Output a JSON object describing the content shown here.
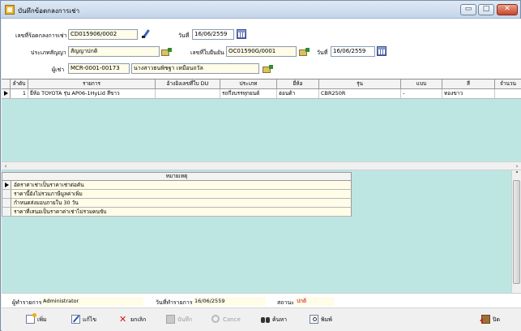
{
  "window": {
    "title": "บันทึกข้อตกลงการเช่า",
    "controls": {
      "minimize": "▭",
      "maximize": "□",
      "close": "✕"
    }
  },
  "form": {
    "agreement_no_label": "เลขที่ร้อตกลงการเช่า",
    "agreement_no_value": "CD015906/0002",
    "date_label": "วันที่",
    "date_value": "16/06/2559",
    "contract_type_label": "ประเภทสัญญา",
    "contract_type_value": "สัญญาปกติ",
    "booking_no_label": "เลขที่ใบยืนยัน",
    "booking_no_value": "OC01590G/0001",
    "booking_date_label": "วันที่",
    "booking_date_value": "16/06/2559",
    "tenant_label": "ผู้เช่า",
    "tenant_code": "MCR-0001-00173",
    "tenant_name": "นางสาวธนพิชฐา เหมือนถวัล"
  },
  "items_grid": {
    "columns": [
      "ลำดับ",
      "รายการ",
      "อ้างอิงเลขที่ใบ DU",
      "ประเภท",
      "ยี่ห้อ",
      "รุ่น",
      "แบบ",
      "สี",
      "จำนวน"
    ],
    "rows": [
      [
        "1",
        "ยี่ห้อ TOYOTA รุ่น AP06-1HyLid สีขาว",
        "",
        "รถกึ่งบรรทุกยนต์",
        "ฮอนด้า",
        "CBR250R",
        "-",
        "ทองขาว",
        ""
      ]
    ]
  },
  "notes_grid": {
    "header": "หมายเหตุ",
    "rows": [
      "อัตราค่าเช่าเป็นราคาเช่าต่อคัน",
      "ราคานี้ยังไม่รวมภาษีมูลค่าเพิ่ม",
      "กำหนดส่งมอบภายใน 30 วัน",
      "ราคาที่เสนอเป็นราคาค่าเช่าไม่รวมคนขับ"
    ]
  },
  "status": {
    "recorder_label": "ผู้ทำรายการ",
    "recorder_value": "Administrator",
    "record_date_label": "วันที่ทำรายการ",
    "record_date_value": "16/06/2559",
    "state_label": "สถานะ",
    "state_value": "ปกติ",
    "state_color": "#d01010"
  },
  "toolbar": {
    "add": "เพิ่ม",
    "edit": "แก้ไข",
    "cancel_doc": "ยกเลิก",
    "save": "บันทึก",
    "cancel": "Cance",
    "search": "ค้นหา",
    "print": "พิมพ์",
    "close": "ปิด"
  },
  "scroll": {
    "left": "‹",
    "right": "›",
    "up": "˄",
    "down": "˅"
  }
}
